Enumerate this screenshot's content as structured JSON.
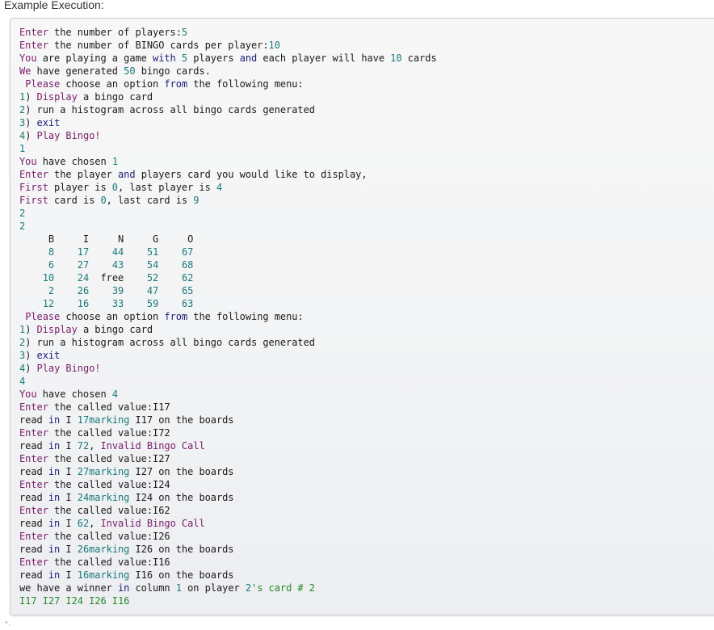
{
  "heading": "Example Execution:",
  "footer_mark": "\"·",
  "colors": {
    "keyword": "#7a1c6b",
    "navy": "#1c1c7a",
    "number": "#1a7a7a",
    "string": "#268a26",
    "plain": "#1a1a1a"
  },
  "console_lines": [
    [
      [
        "kw",
        "Enter"
      ],
      [
        "pl",
        " the number of players:"
      ],
      [
        "num",
        "5"
      ]
    ],
    [
      [
        "kw",
        "Enter"
      ],
      [
        "pl",
        " the number of BINGO cards per player:"
      ],
      [
        "num",
        "10"
      ]
    ],
    [
      [
        "kw",
        "You"
      ],
      [
        "pl",
        " are playing a game "
      ],
      [
        "nv",
        "with"
      ],
      [
        "pl",
        " "
      ],
      [
        "num",
        "5"
      ],
      [
        "pl",
        " players "
      ],
      [
        "nv",
        "and"
      ],
      [
        "pl",
        " each player will have "
      ],
      [
        "num",
        "10"
      ],
      [
        "pl",
        " cards"
      ]
    ],
    [
      [
        "kw",
        "We"
      ],
      [
        "pl",
        " have generated "
      ],
      [
        "num",
        "50"
      ],
      [
        "pl",
        " bingo cards."
      ]
    ],
    [
      [
        "pl",
        " "
      ],
      [
        "kw",
        "Please"
      ],
      [
        "pl",
        " choose an option "
      ],
      [
        "nv",
        "from"
      ],
      [
        "pl",
        " the following menu:"
      ]
    ],
    [
      [
        "num",
        "1"
      ],
      [
        "pl",
        ") "
      ],
      [
        "kw",
        "Display"
      ],
      [
        "pl",
        " a bingo card"
      ]
    ],
    [
      [
        "num",
        "2"
      ],
      [
        "pl",
        ") run a histogram across all bingo cards generated"
      ]
    ],
    [
      [
        "num",
        "3"
      ],
      [
        "pl",
        ") "
      ],
      [
        "nv",
        "exit"
      ]
    ],
    [
      [
        "num",
        "4"
      ],
      [
        "pl",
        ") "
      ],
      [
        "kw",
        "Play Bingo!"
      ]
    ],
    [
      [
        "num",
        "1"
      ]
    ],
    [
      [
        "kw",
        "You"
      ],
      [
        "pl",
        " have chosen "
      ],
      [
        "num",
        "1"
      ]
    ],
    [
      [
        "kw",
        "Enter"
      ],
      [
        "pl",
        " the player "
      ],
      [
        "nv",
        "and"
      ],
      [
        "pl",
        " players card you would like to display,"
      ]
    ],
    [
      [
        "kw",
        "First"
      ],
      [
        "pl",
        " player is "
      ],
      [
        "num",
        "0"
      ],
      [
        "pl",
        ", last player is "
      ],
      [
        "num",
        "4"
      ]
    ],
    [
      [
        "kw",
        "First"
      ],
      [
        "pl",
        " card is "
      ],
      [
        "num",
        "0"
      ],
      [
        "pl",
        ", last card is "
      ],
      [
        "num",
        "9"
      ]
    ],
    [
      [
        "num",
        "2"
      ]
    ],
    [
      [
        "num",
        "2"
      ]
    ],
    [
      [
        "pl",
        "     B     I     N     G     O"
      ]
    ],
    [
      [
        "pl",
        "     "
      ],
      [
        "num",
        "8"
      ],
      [
        "pl",
        "    "
      ],
      [
        "num",
        "17"
      ],
      [
        "pl",
        "    "
      ],
      [
        "num",
        "44"
      ],
      [
        "pl",
        "    "
      ],
      [
        "num",
        "51"
      ],
      [
        "pl",
        "    "
      ],
      [
        "num",
        "67"
      ]
    ],
    [
      [
        "pl",
        "     "
      ],
      [
        "num",
        "6"
      ],
      [
        "pl",
        "    "
      ],
      [
        "num",
        "27"
      ],
      [
        "pl",
        "    "
      ],
      [
        "num",
        "43"
      ],
      [
        "pl",
        "    "
      ],
      [
        "num",
        "54"
      ],
      [
        "pl",
        "    "
      ],
      [
        "num",
        "68"
      ]
    ],
    [
      [
        "pl",
        "    "
      ],
      [
        "num",
        "10"
      ],
      [
        "pl",
        "    "
      ],
      [
        "num",
        "24"
      ],
      [
        "pl",
        "  free    "
      ],
      [
        "num",
        "52"
      ],
      [
        "pl",
        "    "
      ],
      [
        "num",
        "62"
      ]
    ],
    [
      [
        "pl",
        "     "
      ],
      [
        "num",
        "2"
      ],
      [
        "pl",
        "    "
      ],
      [
        "num",
        "26"
      ],
      [
        "pl",
        "    "
      ],
      [
        "num",
        "39"
      ],
      [
        "pl",
        "    "
      ],
      [
        "num",
        "47"
      ],
      [
        "pl",
        "    "
      ],
      [
        "num",
        "65"
      ]
    ],
    [
      [
        "pl",
        "    "
      ],
      [
        "num",
        "12"
      ],
      [
        "pl",
        "    "
      ],
      [
        "num",
        "16"
      ],
      [
        "pl",
        "    "
      ],
      [
        "num",
        "33"
      ],
      [
        "pl",
        "    "
      ],
      [
        "num",
        "59"
      ],
      [
        "pl",
        "    "
      ],
      [
        "num",
        "63"
      ]
    ],
    [
      [
        "pl",
        " "
      ],
      [
        "kw",
        "Please"
      ],
      [
        "pl",
        " choose an option "
      ],
      [
        "nv",
        "from"
      ],
      [
        "pl",
        " the following menu:"
      ]
    ],
    [
      [
        "num",
        "1"
      ],
      [
        "pl",
        ") "
      ],
      [
        "kw",
        "Display"
      ],
      [
        "pl",
        " a bingo card"
      ]
    ],
    [
      [
        "num",
        "2"
      ],
      [
        "pl",
        ") run a histogram across all bingo cards generated"
      ]
    ],
    [
      [
        "num",
        "3"
      ],
      [
        "pl",
        ") "
      ],
      [
        "nv",
        "exit"
      ]
    ],
    [
      [
        "num",
        "4"
      ],
      [
        "pl",
        ") "
      ],
      [
        "kw",
        "Play Bingo!"
      ]
    ],
    [
      [
        "num",
        "4"
      ]
    ],
    [
      [
        "kw",
        "You"
      ],
      [
        "pl",
        " have chosen "
      ],
      [
        "num",
        "4"
      ]
    ],
    [
      [
        "kw",
        "Enter"
      ],
      [
        "pl",
        " the called value:I17"
      ]
    ],
    [
      [
        "pl",
        "read "
      ],
      [
        "nv",
        "in"
      ],
      [
        "pl",
        " I "
      ],
      [
        "num",
        "17marking"
      ],
      [
        "pl",
        " I17 on the boards"
      ]
    ],
    [
      [
        "kw",
        "Enter"
      ],
      [
        "pl",
        " the called value:I72"
      ]
    ],
    [
      [
        "pl",
        "read "
      ],
      [
        "nv",
        "in"
      ],
      [
        "pl",
        " I "
      ],
      [
        "num",
        "72"
      ],
      [
        "pl",
        ", "
      ],
      [
        "kw",
        "Invalid Bingo Call"
      ]
    ],
    [
      [
        "kw",
        "Enter"
      ],
      [
        "pl",
        " the called value:I27"
      ]
    ],
    [
      [
        "pl",
        "read "
      ],
      [
        "nv",
        "in"
      ],
      [
        "pl",
        " I "
      ],
      [
        "num",
        "27marking"
      ],
      [
        "pl",
        " I27 on the boards"
      ]
    ],
    [
      [
        "kw",
        "Enter"
      ],
      [
        "pl",
        " the called value:I24"
      ]
    ],
    [
      [
        "pl",
        "read "
      ],
      [
        "nv",
        "in"
      ],
      [
        "pl",
        " I "
      ],
      [
        "num",
        "24marking"
      ],
      [
        "pl",
        " I24 on the boards"
      ]
    ],
    [
      [
        "kw",
        "Enter"
      ],
      [
        "pl",
        " the called value:I62"
      ]
    ],
    [
      [
        "pl",
        "read "
      ],
      [
        "nv",
        "in"
      ],
      [
        "pl",
        " I "
      ],
      [
        "num",
        "62"
      ],
      [
        "pl",
        ", "
      ],
      [
        "kw",
        "Invalid Bingo Call"
      ]
    ],
    [
      [
        "kw",
        "Enter"
      ],
      [
        "pl",
        " the called value:I26"
      ]
    ],
    [
      [
        "pl",
        "read "
      ],
      [
        "nv",
        "in"
      ],
      [
        "pl",
        " I "
      ],
      [
        "num",
        "26marking"
      ],
      [
        "pl",
        " I26 on the boards"
      ]
    ],
    [
      [
        "kw",
        "Enter"
      ],
      [
        "pl",
        " the called value:I16"
      ]
    ],
    [
      [
        "pl",
        "read "
      ],
      [
        "nv",
        "in"
      ],
      [
        "pl",
        " I "
      ],
      [
        "num",
        "16marking"
      ],
      [
        "pl",
        " I16 on the boards"
      ]
    ],
    [
      [
        "pl",
        "we have a winner "
      ],
      [
        "nv",
        "in"
      ],
      [
        "pl",
        " column "
      ],
      [
        "num",
        "1"
      ],
      [
        "pl",
        " on player "
      ],
      [
        "num",
        "2"
      ],
      [
        "str",
        "'s card # 2"
      ]
    ],
    [
      [
        "str",
        "I17 I27 I24 I26 I16"
      ]
    ]
  ]
}
